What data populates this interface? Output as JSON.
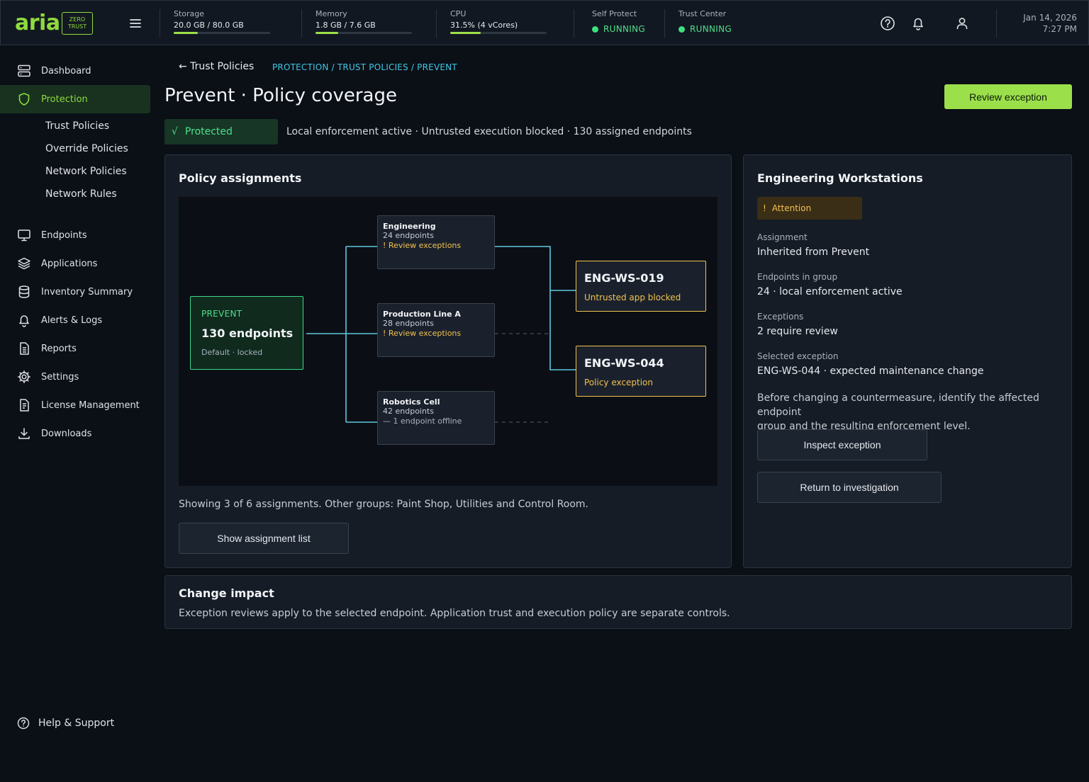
{
  "brand": {
    "name": "aria",
    "badge_line1": "ZERO",
    "badge_line2": "TRUST"
  },
  "topbar": {
    "metrics": [
      {
        "label": "Storage",
        "value": "20.0 GB / 80.0 GB",
        "fraction": 0.25
      },
      {
        "label": "Memory",
        "value": "1.8 GB / 7.6 GB",
        "fraction": 0.237
      },
      {
        "label": "CPU",
        "value": "31.5% (4 vCores)",
        "fraction": 0.315
      }
    ],
    "services": [
      {
        "label": "Self Protect",
        "status": "RUNNING"
      },
      {
        "label": "Trust Center",
        "status": "RUNNING"
      }
    ],
    "date": "Jan 14, 2026",
    "time": "7:27 PM",
    "colors": {
      "accent": "#9be04b",
      "running": "#3ee07e"
    }
  },
  "sidebar": {
    "items": [
      {
        "label": "Dashboard",
        "icon": "server-icon"
      },
      {
        "label": "Protection",
        "icon": "shield-icon",
        "active": true
      },
      {
        "label": "Endpoints",
        "icon": "monitor-icon"
      },
      {
        "label": "Applications",
        "icon": "layers-icon"
      },
      {
        "label": "Inventory Summary",
        "icon": "database-icon"
      },
      {
        "label": "Alerts & Logs",
        "icon": "bell-icon"
      },
      {
        "label": "Reports",
        "icon": "document-icon"
      },
      {
        "label": "Settings",
        "icon": "gear-icon"
      },
      {
        "label": "License Management",
        "icon": "license-icon"
      },
      {
        "label": "Downloads",
        "icon": "download-icon"
      }
    ],
    "sub_items": [
      "Trust Policies",
      "Override Policies",
      "Network Policies",
      "Network Rules"
    ],
    "help": "Help & Support"
  },
  "main": {
    "back_link": "← Trust Policies",
    "breadcrumb": "PROTECTION / TRUST POLICIES / PREVENT",
    "title": "Prevent · Policy coverage",
    "primary_action": "Review exception",
    "status_badge": "Protected",
    "status_badge_icon": "√",
    "status_line": "Local enforcement active · Untrusted execution blocked · 130 assigned endpoints"
  },
  "assignments": {
    "title": "Policy assignments",
    "root": {
      "label": "PREVENT",
      "count": "130 endpoints",
      "note": "Default · locked"
    },
    "groups": [
      {
        "name": "Engineering",
        "count": "24 endpoints",
        "note": "! Review exceptions",
        "note_type": "warning"
      },
      {
        "name": "Production Line A",
        "count": "28 endpoints",
        "note": "! Review exceptions",
        "note_type": "warning"
      },
      {
        "name": "Robotics Cell",
        "count": "42 endpoints",
        "note": "— 1 endpoint offline",
        "note_type": "muted"
      }
    ],
    "endpoints": [
      {
        "id": "ENG-WS-019",
        "note": "Untrusted app blocked"
      },
      {
        "id": "ENG-WS-044",
        "note": "Policy exception"
      }
    ],
    "footer": "Showing 3 of 6 assignments. Other groups: Paint Shop, Utilities and Control Room.",
    "list_button": "Show assignment list"
  },
  "details": {
    "title": "Engineering Workstations",
    "badge": "Attention",
    "badge_icon": "!",
    "fields": [
      {
        "label": "Assignment",
        "value": "Inherited from Prevent"
      },
      {
        "label": "Endpoints in group",
        "value": "24 · local enforcement active"
      },
      {
        "label": "Exceptions",
        "value": "2 require review"
      },
      {
        "label": "Selected exception",
        "value": "ENG-WS-044 · expected maintenance change"
      }
    ],
    "guidance_line1": "Before changing a countermeasure, identify the affected endpoint",
    "guidance_line2": "group and the resulting enforcement level.",
    "inspect_button": "Inspect exception",
    "return_button": "Return to investigation"
  },
  "impact": {
    "title": "Change impact",
    "text": "Exception reviews apply to the selected endpoint. Application trust and execution policy are separate controls."
  }
}
